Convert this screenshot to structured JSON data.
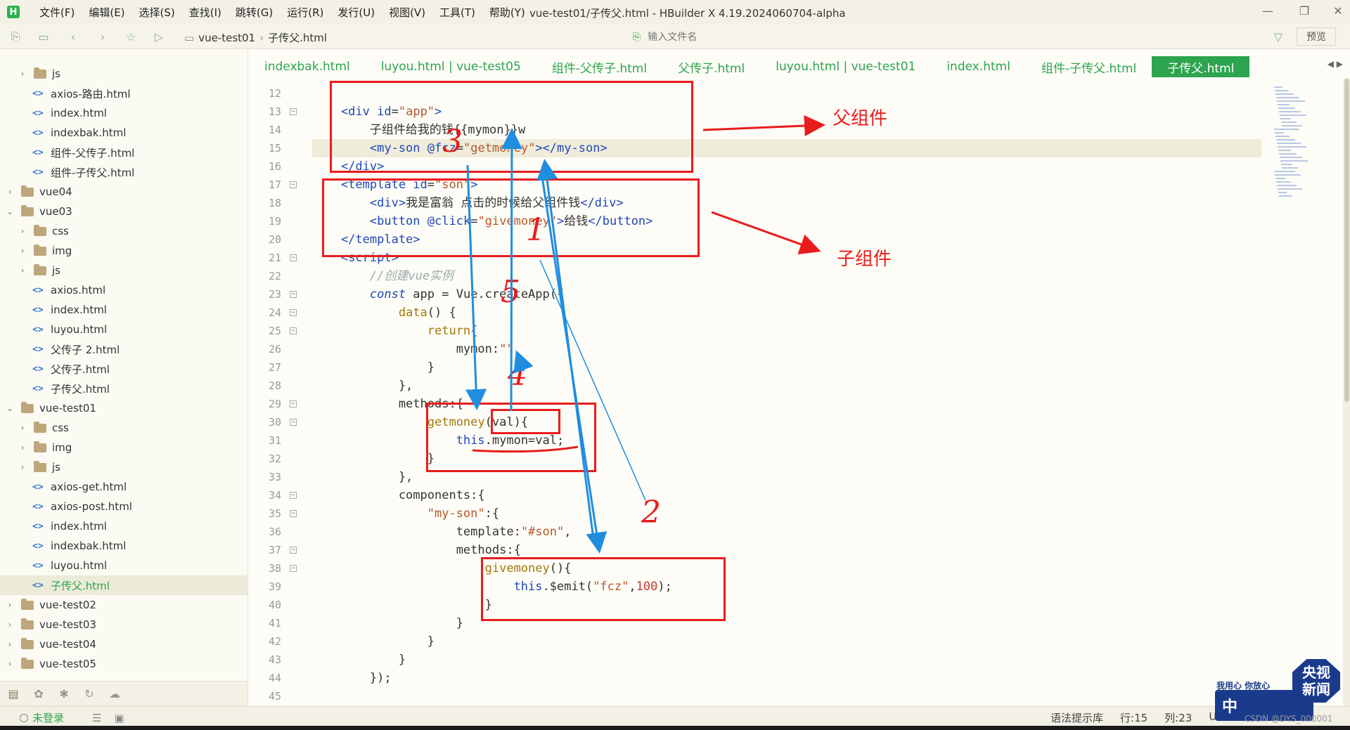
{
  "window": {
    "title": "vue-test01/子传父.html - HBuilder X 4.19.2024060704-alpha",
    "logo": "H"
  },
  "menu": [
    "文件(F)",
    "编辑(E)",
    "选择(S)",
    "查找(I)",
    "跳转(G)",
    "运行(R)",
    "发行(U)",
    "视图(V)",
    "工具(T)",
    "帮助(Y)"
  ],
  "toolbar": {
    "breadcrumb": [
      "vue-test01",
      "子传父.html"
    ],
    "file_search_placeholder": "输入文件名",
    "preview_label": "预览"
  },
  "sidebar": {
    "tree": [
      {
        "type": "folder",
        "label": "js",
        "level": 1,
        "expanded": false
      },
      {
        "type": "file",
        "label": "axios-路由.html",
        "level": 1
      },
      {
        "type": "file",
        "label": "index.html",
        "level": 1
      },
      {
        "type": "file",
        "label": "indexbak.html",
        "level": 1
      },
      {
        "type": "file",
        "label": "组件-父传子.html",
        "level": 1
      },
      {
        "type": "file",
        "label": "组件-子传父.html",
        "level": 1
      },
      {
        "type": "folder",
        "label": "vue04",
        "level": 0,
        "expanded": false
      },
      {
        "type": "folder",
        "label": "vue03",
        "level": 0,
        "expanded": true
      },
      {
        "type": "folder",
        "label": "css",
        "level": 1,
        "expanded": false
      },
      {
        "type": "folder",
        "label": "img",
        "level": 1,
        "expanded": false
      },
      {
        "type": "folder",
        "label": "js",
        "level": 1,
        "expanded": false
      },
      {
        "type": "file",
        "label": "axios.html",
        "level": 1
      },
      {
        "type": "file",
        "label": "index.html",
        "level": 1
      },
      {
        "type": "file",
        "label": "luyou.html",
        "level": 1
      },
      {
        "type": "file",
        "label": "父传子 2.html",
        "level": 1
      },
      {
        "type": "file",
        "label": "父传子.html",
        "level": 1
      },
      {
        "type": "file",
        "label": "子传父.html",
        "level": 1
      },
      {
        "type": "folder",
        "label": "vue-test01",
        "level": 0,
        "expanded": true
      },
      {
        "type": "folder",
        "label": "css",
        "level": 1,
        "expanded": false
      },
      {
        "type": "folder",
        "label": "img",
        "level": 1,
        "expanded": false
      },
      {
        "type": "folder",
        "label": "js",
        "level": 1,
        "expanded": false
      },
      {
        "type": "file",
        "label": "axios-get.html",
        "level": 1
      },
      {
        "type": "file",
        "label": "axios-post.html",
        "level": 1
      },
      {
        "type": "file",
        "label": "index.html",
        "level": 1
      },
      {
        "type": "file",
        "label": "indexbak.html",
        "level": 1
      },
      {
        "type": "file",
        "label": "luyou.html",
        "level": 1
      },
      {
        "type": "file",
        "label": "子传父.html",
        "level": 1,
        "active": true
      },
      {
        "type": "folder",
        "label": "vue-test02",
        "level": 0,
        "expanded": false
      },
      {
        "type": "folder",
        "label": "vue-test03",
        "level": 0,
        "expanded": false
      },
      {
        "type": "folder",
        "label": "vue-test04",
        "level": 0,
        "expanded": false
      },
      {
        "type": "folder",
        "label": "vue-test05",
        "level": 0,
        "expanded": false
      }
    ]
  },
  "tabs": [
    {
      "label": "indexbak.html"
    },
    {
      "label": "luyou.html | vue-test05"
    },
    {
      "label": "组件-父传子.html"
    },
    {
      "label": "父传子.html"
    },
    {
      "label": "luyou.html | vue-test01"
    },
    {
      "label": "index.html"
    },
    {
      "label": "组件-子传父.html"
    },
    {
      "label": "子传父.html",
      "active": true
    }
  ],
  "editor": {
    "line_numbers": [
      "12",
      "13",
      "14",
      "15",
      "16",
      "17",
      "18",
      "19",
      "20",
      "21",
      "22",
      "23",
      "24",
      "25",
      "26",
      "27",
      "28",
      "29",
      "30",
      "31",
      "32",
      "33",
      "34",
      "35",
      "36",
      "37",
      "38",
      "39",
      "40",
      "41",
      "42",
      "43",
      "44",
      "45"
    ],
    "folds": [
      "13",
      "17",
      "21",
      "23",
      "24",
      "25",
      "29",
      "30",
      "34",
      "35",
      "37",
      "38"
    ],
    "highlighted_line": "15",
    "lines": [
      [],
      [
        {
          "c": "tag",
          "t": "    <div "
        },
        {
          "c": "attr",
          "t": "id"
        },
        {
          "c": "ch",
          "t": "="
        },
        {
          "c": "str",
          "t": "\"app\""
        },
        {
          "c": "tag",
          "t": ">"
        }
      ],
      [
        {
          "c": "ch",
          "t": "        子组件给我的钱{{mymon}}w"
        }
      ],
      [
        {
          "c": "tag",
          "t": "        <my-son "
        },
        {
          "c": "attr",
          "t": "@fcz"
        },
        {
          "c": "ch",
          "t": "="
        },
        {
          "c": "str",
          "t": "\"getmoney\""
        },
        {
          "c": "tag",
          "t": "></my-son>"
        }
      ],
      [
        {
          "c": "tag",
          "t": "    </div>"
        }
      ],
      [
        {
          "c": "tag",
          "t": "    <template "
        },
        {
          "c": "attr",
          "t": "id"
        },
        {
          "c": "ch",
          "t": "="
        },
        {
          "c": "str",
          "t": "\"son\""
        },
        {
          "c": "tag",
          "t": ">"
        }
      ],
      [
        {
          "c": "tag",
          "t": "        <div>"
        },
        {
          "c": "ch",
          "t": "我是富翁 点击的时候给父组件钱"
        },
        {
          "c": "tag",
          "t": "</div>"
        }
      ],
      [
        {
          "c": "tag",
          "t": "        <button "
        },
        {
          "c": "attr",
          "t": "@click"
        },
        {
          "c": "ch",
          "t": "="
        },
        {
          "c": "str",
          "t": "\"givemoney\""
        },
        {
          "c": "tag",
          "t": ">"
        },
        {
          "c": "ch",
          "t": "给钱"
        },
        {
          "c": "tag",
          "t": "</button>"
        }
      ],
      [
        {
          "c": "tag",
          "t": "    </template>"
        }
      ],
      [
        {
          "c": "tag",
          "t": "    <script>"
        }
      ],
      [
        {
          "c": "cmt",
          "t": "        //创建vue实例"
        }
      ],
      [
        {
          "c": "kwi",
          "t": "        const "
        },
        {
          "c": "ch",
          "t": "app = Vue.createApp({"
        }
      ],
      [
        {
          "c": "kw",
          "t": "            data"
        },
        {
          "c": "ch",
          "t": "() {"
        }
      ],
      [
        {
          "c": "kw",
          "t": "                return"
        },
        {
          "c": "ch",
          "t": "{"
        }
      ],
      [
        {
          "c": "ch",
          "t": "                    mymon:"
        },
        {
          "c": "str",
          "t": "\"\""
        }
      ],
      [
        {
          "c": "ch",
          "t": "                }"
        }
      ],
      [
        {
          "c": "ch",
          "t": "            },"
        }
      ],
      [
        {
          "c": "ch",
          "t": "            methods:{"
        }
      ],
      [
        {
          "c": "kw",
          "t": "                getmoney"
        },
        {
          "c": "ch",
          "t": "(val){"
        }
      ],
      [
        {
          "c": "this",
          "t": "                    this"
        },
        {
          "c": "ch",
          "t": ".mymon=val;"
        }
      ],
      [
        {
          "c": "ch",
          "t": "                }"
        }
      ],
      [
        {
          "c": "ch",
          "t": "            },"
        }
      ],
      [
        {
          "c": "ch",
          "t": "            components:{"
        }
      ],
      [
        {
          "c": "str",
          "t": "                \"my-son\""
        },
        {
          "c": "ch",
          "t": ":{"
        }
      ],
      [
        {
          "c": "ch",
          "t": "                    template:"
        },
        {
          "c": "str",
          "t": "\"#son\""
        },
        {
          "c": "ch",
          "t": ","
        }
      ],
      [
        {
          "c": "ch",
          "t": "                    methods:{"
        }
      ],
      [
        {
          "c": "kw",
          "t": "                        givemoney"
        },
        {
          "c": "ch",
          "t": "(){"
        }
      ],
      [
        {
          "c": "this",
          "t": "                            this"
        },
        {
          "c": "ch",
          "t": ".$emit("
        },
        {
          "c": "str",
          "t": "\"fcz\""
        },
        {
          "c": "ch",
          "t": ","
        },
        {
          "c": "num",
          "t": "100"
        },
        {
          "c": "ch",
          "t": ");"
        }
      ],
      [
        {
          "c": "ch",
          "t": "                        }"
        }
      ],
      [
        {
          "c": "ch",
          "t": "                    }"
        }
      ],
      [
        {
          "c": "ch",
          "t": "                }"
        }
      ],
      [
        {
          "c": "ch",
          "t": "            }"
        }
      ],
      [
        {
          "c": "ch",
          "t": "        });"
        }
      ],
      []
    ]
  },
  "annotations": {
    "parent_label": "父组件",
    "child_label": "子组件",
    "numbers": [
      "1",
      "2",
      "3",
      "4",
      "5"
    ],
    "color": "#e81c1c",
    "arrow_color": "#1f8de0"
  },
  "status": {
    "login": "未登录",
    "syntax_lib": "语法提示库",
    "line": "行:15",
    "col": "列:23",
    "encoding": "UT"
  },
  "watermark": {
    "logo_line1": "央视",
    "logo_line2": "新闻",
    "slogan": "我用心 你放心",
    "badge": "中",
    "credit": "CSDN @DYS_000001"
  }
}
